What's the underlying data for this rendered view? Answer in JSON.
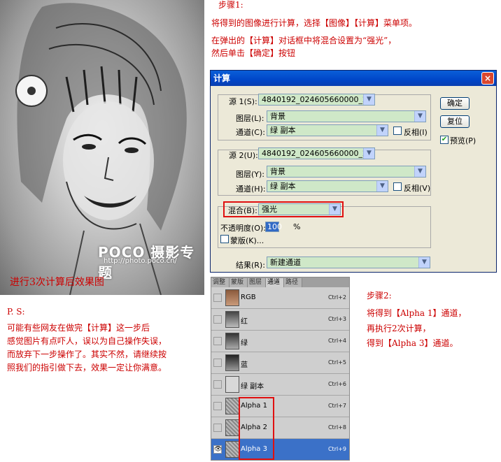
{
  "photo": {
    "watermark": "POCO 摄影专题",
    "watermark_url": "http://photo.poco.cn/",
    "caption": "进行3次计算后效果图"
  },
  "step1": {
    "title": "步骤1:",
    "line1": "将得到的图像进行计算，选择【图像】【计算】菜单项。",
    "line2": "在弹出的【计算】对话框中将混合设置为“强光”，",
    "line3": "然后单击【确定】按钮"
  },
  "dialog": {
    "title": "计算",
    "close": "×",
    "source1": {
      "label": "源 1(S):",
      "file": "4840192_024605660000_2.j...",
      "layer_label": "图层(L):",
      "layer": "背景",
      "channel_label": "通道(C):",
      "channel": "绿 副本",
      "invert_label": "反相(I)"
    },
    "source2": {
      "label": "源 2(U):",
      "file": "4840192_024605660000_2.j...",
      "layer_label": "图层(Y):",
      "layer": "背景",
      "channel_label": "通道(H):",
      "channel": "绿 副本",
      "invert_label": "反相(V)"
    },
    "blend_label": "混合(B):",
    "blend": "强光",
    "opacity_label": "不透明度(O):",
    "opacity": "100",
    "opacity_unit": "%",
    "mask_label": "蒙版(K)...",
    "result_label": "结果(R):",
    "result": "新建通道",
    "ok": "确定",
    "reset": "复位",
    "preview_label": "预览(P)",
    "preview_checked": true
  },
  "channels": {
    "tabs": [
      "调整",
      "蒙版",
      "图层",
      "通道",
      "路径"
    ],
    "active_tab": "通道",
    "rows": [
      {
        "name": "RGB",
        "key": "Ctrl+2",
        "thumb": "color"
      },
      {
        "name": "红",
        "key": "Ctrl+3",
        "thumb": "gray"
      },
      {
        "name": "绿",
        "key": "Ctrl+4",
        "thumb": "gray"
      },
      {
        "name": "蓝",
        "key": "Ctrl+5",
        "thumb": "gray"
      },
      {
        "name": "绿 副本",
        "key": "Ctrl+6",
        "thumb": "light"
      },
      {
        "name": "Alpha 1",
        "key": "Ctrl+7",
        "thumb": "noise"
      },
      {
        "name": "Alpha 2",
        "key": "Ctrl+8",
        "thumb": "noise"
      },
      {
        "name": "Alpha 3",
        "key": "Ctrl+9",
        "thumb": "noise",
        "selected": true,
        "visible": true
      }
    ]
  },
  "step2": {
    "title": "步骤2:",
    "line1": "将得到【Alpha 1】通道，",
    "line2": "再执行2次计算，",
    "line3": "得到【Alpha 3】通道。"
  },
  "ps": {
    "title": "P. S:",
    "line1": "可能有些网友在做完【计算】这一步后",
    "line2": "感觉图片有点吓人，误以为自己操作失误，",
    "line3": "而放弃下一步操作了。其实不然，请继续按",
    "line4": "照我们的指引做下去，效果一定让你满意。"
  },
  "colors": {
    "accent": "#cc0000",
    "highlight": "#e01010",
    "selection": "#3b71c8"
  }
}
